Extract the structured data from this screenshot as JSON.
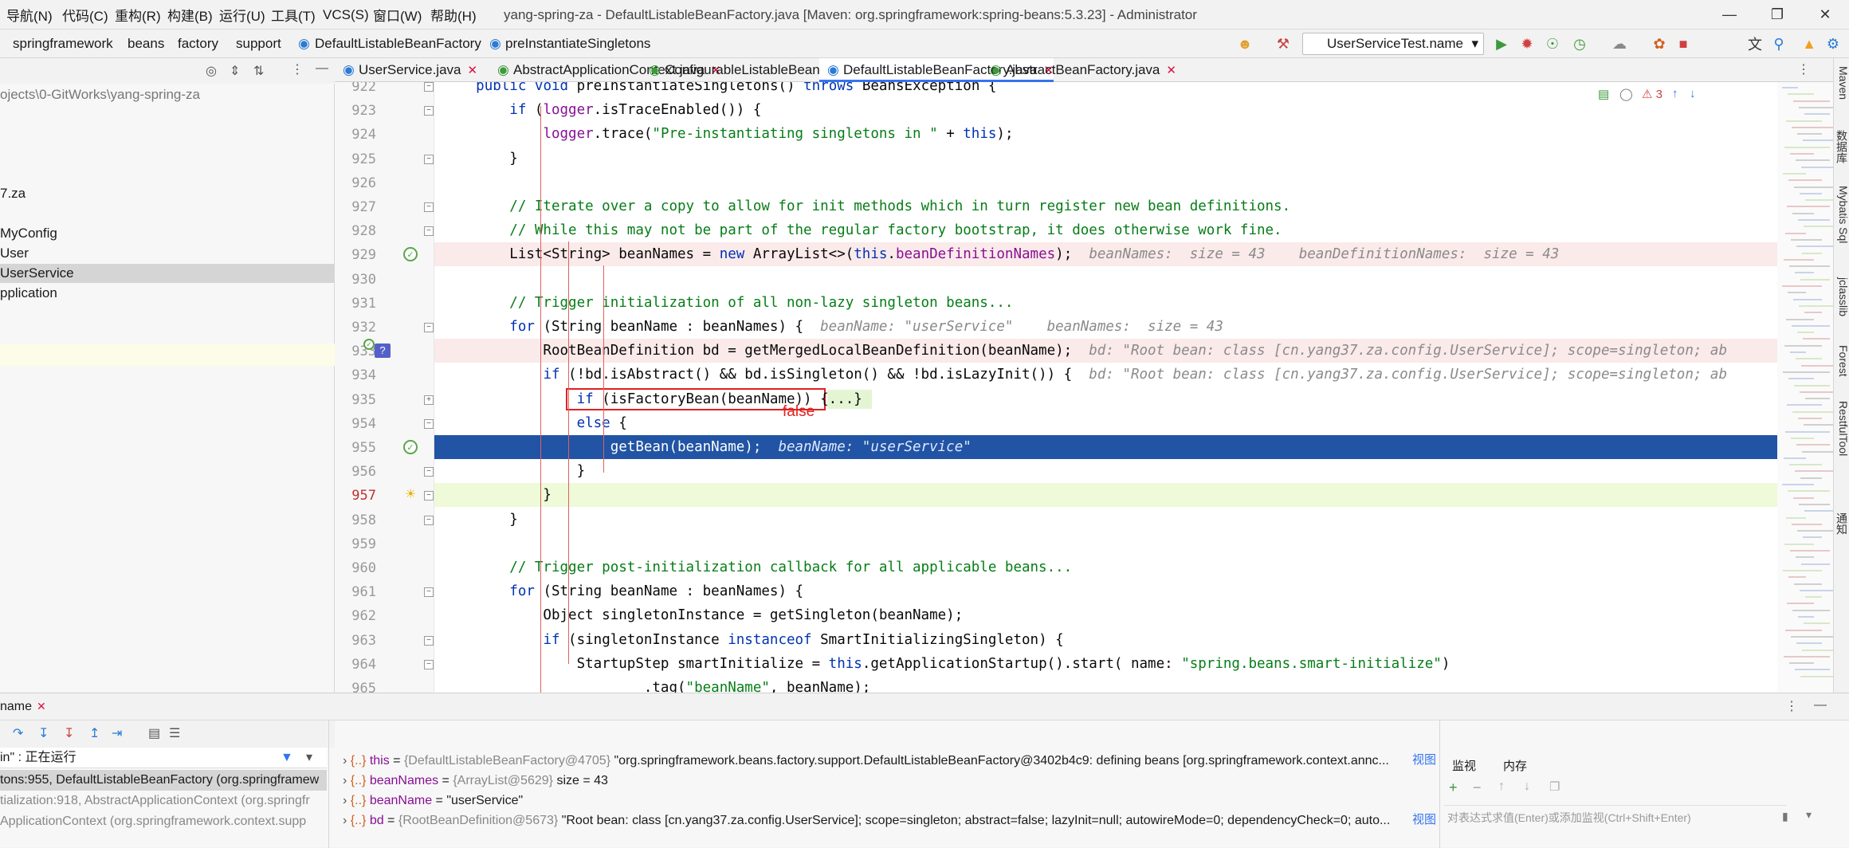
{
  "window": {
    "title": "yang-spring-za - DefaultListableBeanFactory.java [Maven: org.springframework:spring-beans:5.3.23] - Administrator"
  },
  "menu": [
    "导航(N)",
    "代码(C)",
    "重构(R)",
    "构建(B)",
    "运行(U)",
    "工具(T)",
    "VCS(S)",
    "窗口(W)",
    "帮助(H)"
  ],
  "breadcrumbs": [
    "springframework",
    "beans",
    "factory",
    "support",
    "DefaultListableBeanFactory",
    "preInstantiateSingletons"
  ],
  "run_config": "UserServiceTest.name",
  "left_panel": {
    "path": "ojects\\0-GitWorks\\yang-spring-za",
    "items": [
      "7.za",
      "MyConfig",
      "User",
      "UserService",
      "pplication"
    ],
    "selected": "UserService"
  },
  "tabs": [
    {
      "label": "UserService.java",
      "active": false
    },
    {
      "label": "AbstractApplicationContext.java",
      "active": false
    },
    {
      "label": "ConfigurableListableBeanFactory.java",
      "active": false
    },
    {
      "label": "DefaultListableBeanFactory.java",
      "active": true
    },
    {
      "label": "AbstractBeanFactory.java",
      "active": false
    }
  ],
  "editor": {
    "error_count": "3",
    "lines": [
      {
        "n": "922",
        "code": "    public void preInstantiateSingletons() throws BeansException {"
      },
      {
        "n": "923",
        "code": "        if (logger.isTraceEnabled()) {"
      },
      {
        "n": "924",
        "code": "            logger.trace(\"Pre-instantiating singletons in \" + this);"
      },
      {
        "n": "925",
        "code": "        }"
      },
      {
        "n": "926",
        "code": ""
      },
      {
        "n": "927",
        "code": "        // Iterate over a copy to allow for init methods which in turn register new bean definitions."
      },
      {
        "n": "928",
        "code": "        // While this may not be part of the regular factory bootstrap, it does otherwise work fine."
      },
      {
        "n": "929",
        "code": "        List<String> beanNames = new ArrayList<>(this.beanDefinitionNames);",
        "hint": "beanNames:  size = 43    beanDefinitionNames:  size = 43"
      },
      {
        "n": "930",
        "code": ""
      },
      {
        "n": "931",
        "code": "        // Trigger initialization of all non-lazy singleton beans..."
      },
      {
        "n": "932",
        "code": "        for (String beanName : beanNames) {",
        "hint": "beanName: \"userService\"    beanNames:  size = 43"
      },
      {
        "n": "933",
        "code": "            RootBeanDefinition bd = getMergedLocalBeanDefinition(beanName);",
        "hint": "bd: \"Root bean: class [cn.yang37.za.config.UserService]; scope=singleton; ab"
      },
      {
        "n": "934",
        "code": "            if (!bd.isAbstract() && bd.isSingleton() && !bd.isLazyInit()) {",
        "hint": "bd: \"Root bean: class [cn.yang37.za.config.UserService]; scope=singleton; ab"
      },
      {
        "n": "935",
        "code": "                if (isFactoryBean(beanName)) {...}"
      },
      {
        "n": "954",
        "code": "                else {"
      },
      {
        "n": "955",
        "code": "                    getBean(beanName);",
        "hint": "beanName: \"userService\""
      },
      {
        "n": "956",
        "code": "                }"
      },
      {
        "n": "957",
        "code": "            }"
      },
      {
        "n": "958",
        "code": "        }"
      },
      {
        "n": "959",
        "code": ""
      },
      {
        "n": "960",
        "code": "        // Trigger post-initialization callback for all applicable beans..."
      },
      {
        "n": "961",
        "code": "        for (String beanName : beanNames) {"
      },
      {
        "n": "962",
        "code": "            Object singletonInstance = getSingleton(beanName);"
      },
      {
        "n": "963",
        "code": "            if (singletonInstance instanceof SmartInitializingSingleton) {"
      },
      {
        "n": "964",
        "code": "                StartupStep smartInitialize = this.getApplicationStartup().start( name: \"spring.beans.smart-initialize\")"
      },
      {
        "n": "965",
        "code": "                        .tag(\"beanName\", beanName);"
      }
    ],
    "annotation": "false"
  },
  "right_tools": [
    "Maven",
    "数据库",
    "Mybatis Sql",
    "jclasslib",
    "Forest",
    "RestfulTool",
    "通知"
  ],
  "debug": {
    "tab": "name",
    "thread": "in\" : 正在运行",
    "frames": [
      "tons:955, DefaultListableBeanFactory (org.springframew",
      "tialization:918, AbstractApplicationContext (org.springfr",
      "ApplicationContext (org.springframework.context.supp"
    ],
    "variables": [
      {
        "name": "this",
        "type": "{DefaultListableBeanFactory@4705}",
        "value": "\"org.springframework.beans.factory.support.DefaultListableBeanFactory@3402b4c9: defining beans [org.springframework.context.annc...",
        "link": "视图"
      },
      {
        "name": "beanNames",
        "type": "{ArrayList@5629}",
        "value": "size = 43",
        "link": ""
      },
      {
        "name": "beanName",
        "type": "",
        "value": "\"userService\"",
        "link": ""
      },
      {
        "name": "bd",
        "type": "{RootBeanDefinition@5673}",
        "value": "\"Root bean: class [cn.yang37.za.config.UserService]; scope=singleton; abstract=false; lazyInit=null; autowireMode=0; dependencyCheck=0; auto...",
        "link": "视图"
      }
    ],
    "watch_tabs": [
      "监视",
      "内存"
    ],
    "watch_placeholder": "对表达式求值(Enter)或添加监视(Ctrl+Shift+Enter)"
  }
}
